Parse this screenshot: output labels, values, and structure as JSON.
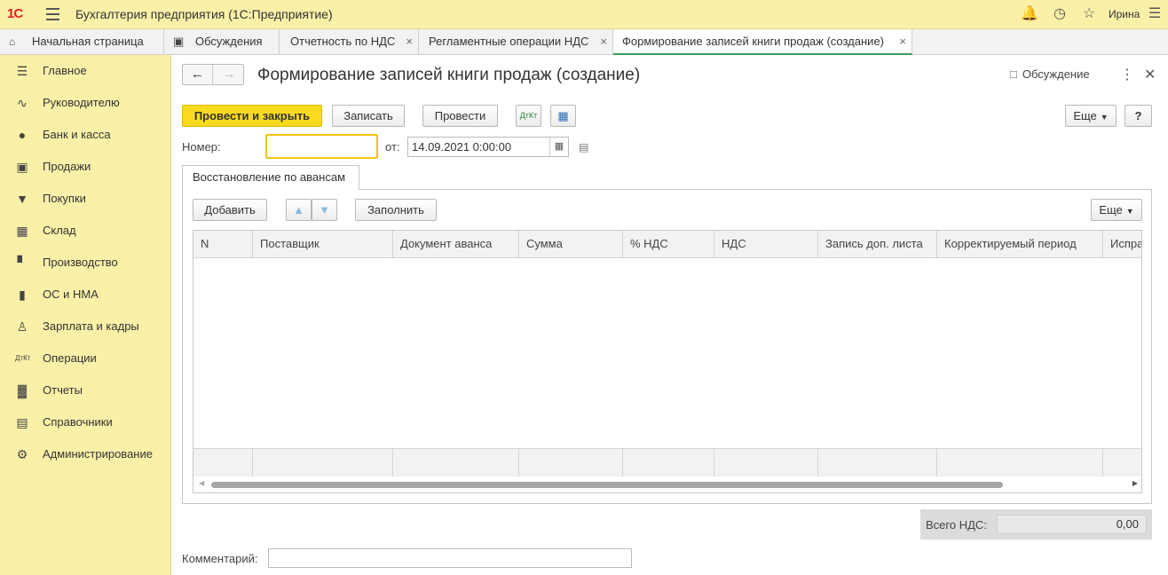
{
  "app": {
    "logo": "1С",
    "title": "Бухгалтерия предприятия (1С:Предприятие)",
    "user": "Ирина"
  },
  "tabs": [
    {
      "label": "Начальная страница"
    },
    {
      "label": "Обсуждения"
    },
    {
      "label": "Отчетность по НДС",
      "close": "×"
    },
    {
      "label": "Регламентные операции НДС",
      "close": "×"
    },
    {
      "label": "Формирование записей книги продаж (создание)",
      "close": "×",
      "active": true
    }
  ],
  "sidebar": {
    "items": [
      {
        "label": "Главное",
        "icon": "menu-lines-icon"
      },
      {
        "label": "Руководителю",
        "icon": "trend-icon"
      },
      {
        "label": "Банк и касса",
        "icon": "ruble-coin-icon"
      },
      {
        "label": "Продажи",
        "icon": "shopping-bag-icon"
      },
      {
        "label": "Покупки",
        "icon": "cart-icon"
      },
      {
        "label": "Склад",
        "icon": "warehouse-grid-icon"
      },
      {
        "label": "Производство",
        "icon": "factory-icon"
      },
      {
        "label": "ОС и НМА",
        "icon": "truck-icon"
      },
      {
        "label": "Зарплата и кадры",
        "icon": "person-icon"
      },
      {
        "label": "Операции",
        "icon": "dt-kt-icon"
      },
      {
        "label": "Отчеты",
        "icon": "bar-chart-icon"
      },
      {
        "label": "Справочники",
        "icon": "books-icon"
      },
      {
        "label": "Администрирование",
        "icon": "gear-icon"
      }
    ]
  },
  "form": {
    "title": "Формирование записей книги продаж (создание)",
    "discuss_label": "Обсуждение",
    "toolbar": {
      "post_close": "Провести и закрыть",
      "save": "Записать",
      "post": "Провести",
      "dtkt": "ДтКт",
      "more": "Еще",
      "help": "?"
    },
    "number_label": "Номер:",
    "number_value": "",
    "date_label": "от:",
    "date_value": "14.09.2021  0:00:00",
    "tab_label": "Восстановление по авансам",
    "table_toolbar": {
      "add": "Добавить",
      "fill": "Заполнить",
      "more": "Еще"
    },
    "columns": [
      "N",
      "Поставщик",
      "Документ аванса",
      "Сумма",
      "% НДС",
      "НДС",
      "Запись доп. листа",
      "Корректируемый период",
      "Испра"
    ],
    "total_label": "Всего НДС:",
    "total_value": "0,00",
    "comment_label": "Комментарий:",
    "comment_value": ""
  }
}
